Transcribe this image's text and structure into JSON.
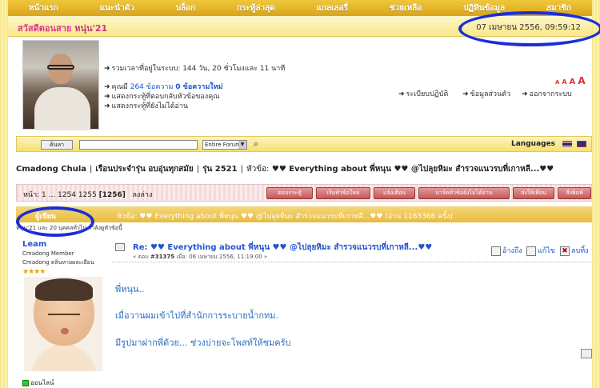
{
  "nav": [
    "หน้าแรก",
    "แนะนำตัว",
    "บล็อก",
    "กระทู้ล่าสุด",
    "แกลเลอรี่",
    "ช่วยเหลือ",
    "ปฏิทินข้อมูล",
    "สมาชิก"
  ],
  "greeting": {
    "label": "สวัสดีตอนสาย",
    "user": "หนุ่น'21"
  },
  "datetime": "07 เมษายน 2556, 09:59:12",
  "profile": {
    "online_time": "รวมเวลาที่อยู่ในระบบ: 144 วัน, 20 ชั่วโมงและ 11 นาที",
    "you_prefix": "คุณมี",
    "post_count": "264 ข้อความ",
    "new_count": "0 ข้อความใหม่",
    "replies_link": "แสดงกระทู้ที่ตอบกลับหัวข้อของคุณ",
    "unread_link": "แสดงกระทู้ที่ยังไม่ได้อ่าน",
    "rules_link": "ระเบียบปฏิบัติ",
    "profile_link": "ข้อมูลส่วนตัว",
    "logout_link": "ออกจากระบบ",
    "font_sizes": [
      "A",
      "A",
      "A",
      "A"
    ]
  },
  "search": {
    "button": "ค้นหา",
    "scope": "Entire Forum",
    "languages": "Languages"
  },
  "breadcrumb": {
    "forum": "Cmadong Chula",
    "board": "เรือนประจำรุ่น อบอุ่นทุกสมัย",
    "year": "รุ่น 2521",
    "topic_prefix": "หัวข้อ:",
    "topic": "♥♥ Everything about พี่หนุน ♥♥ @ไปลุยหิมะ สำรวจแนวรบที่เกาหลี...♥♥"
  },
  "pagination": {
    "prefix": "หน้า: 1 ... 1254 1255",
    "current": "[1256]",
    "down": "ลงล่าง"
  },
  "toolbar": [
    "ตอบกระทู้",
    "เริ่มหัวข้อใหม่",
    "แจ้งเตือน",
    "มาร์คหัวข้อยังไม่ได้อ่าน",
    "ส่งให้เพื่อน",
    "สั่งพิมพ์"
  ],
  "topic_header": {
    "author_label": "ผู้เขียน",
    "title": "หัวข้อ: ♥♥ Everything about พี่หนุน ♥♥ @ไปลุยหิมะ สำรวจแนวรบที่เกาหลี...♥♥  (อ่าน 1163366 ครั้ง)"
  },
  "viewers": "หนุ่น'21 และ 20 บุคคลทั่วไป กำลังดูหัวข้อนี้",
  "post": {
    "user": "Leam",
    "rank1": "Cmadong Member",
    "rank2": "Cmadong ดลิ่นหายผละเยียน",
    "stars": "★★★★",
    "title": "Re: ♥♥ Everything about พี่หนุน ♥♥ @ไปลุยหิมะ สำรวจแนวรบที่เกาหลี...♥♥",
    "meta_prefix": "« ตอบ",
    "post_no": "#31375",
    "meta_suffix": "เมื่อ: 06 เมษายน 2556, 11:19:00 »",
    "quote": "อ้างถึง",
    "edit": "แก้ไข",
    "delete": "ลบทิ้ง",
    "lines": [
      "พี่หนุน..",
      "เมื่อวานผมเข้าไปที่สำนักการระบายน้ำกทม.",
      "มีรูปมาฝากพี่ด้วย... ช่วงบ่ายจะโพสท์ให้ชมครับ"
    ],
    "online": "ออนไลน์"
  }
}
